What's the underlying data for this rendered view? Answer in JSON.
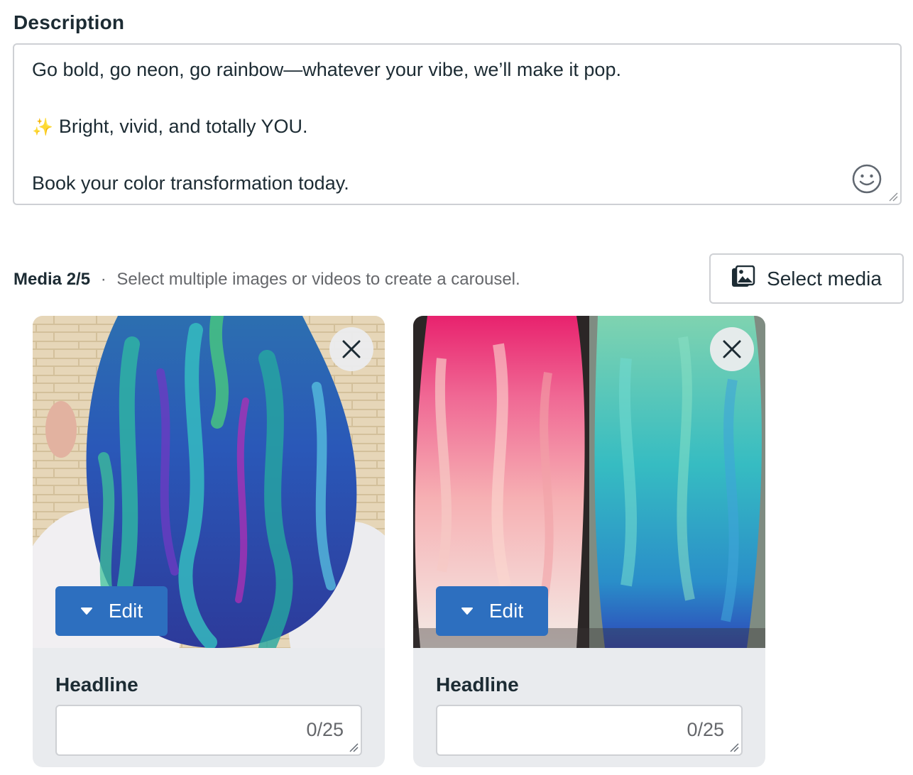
{
  "description": {
    "label": "Description",
    "lines": [
      "Go bold, go neon, go rainbow—whatever your vibe, we’ll make it pop.",
      "Bright, vivid, and totally YOU.",
      "Book your color transformation today."
    ],
    "sparkle": "✨"
  },
  "media": {
    "title": "Media",
    "count": "2/5",
    "separator": "·",
    "hint": "Select multiple images or videos to create a carousel.",
    "select_label": "Select media"
  },
  "cards": [
    {
      "edit_label": "Edit",
      "headline_label": "Headline",
      "headline_value": "",
      "counter": "0/25"
    },
    {
      "edit_label": "Edit",
      "headline_label": "Headline",
      "headline_value": "",
      "counter": "0/25"
    }
  ],
  "colors": {
    "accent": "#2d6fbf",
    "border": "#ced0d4",
    "muted_text": "#65676b"
  }
}
